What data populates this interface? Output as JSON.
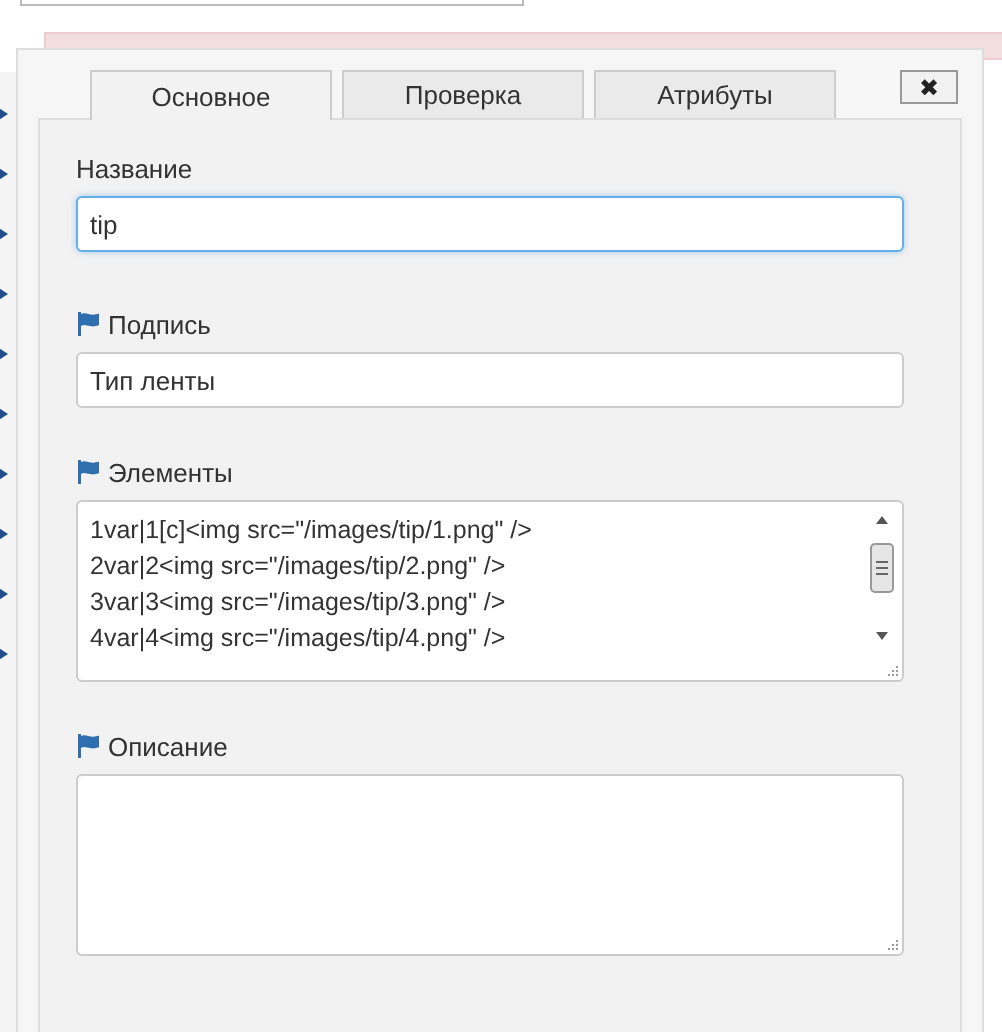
{
  "dialog": {
    "tabs": [
      {
        "label": "Основное",
        "selected": true
      },
      {
        "label": "Проверка",
        "selected": false
      },
      {
        "label": "Атрибуты",
        "selected": false
      }
    ],
    "close_label": "✖",
    "fields": [
      {
        "label": "Название",
        "flagged": false,
        "kind": "input",
        "value": "tip"
      },
      {
        "label": "Подпись",
        "flagged": true,
        "kind": "input",
        "value": "Тип ленты"
      },
      {
        "label": "Элементы",
        "flagged": true,
        "kind": "textarea",
        "lines": [
          "1var|1[c]<img src=\"/images/tip/1.png\" />",
          "2var|2<img src=\"/images/tip/2.png\" />",
          "3var|3<img src=\"/images/tip/3.png\" />",
          "4var|4<img src=\"/images/tip/4.png\" />"
        ]
      },
      {
        "label": "Описание",
        "flagged": true,
        "kind": "textarea"
      }
    ]
  }
}
